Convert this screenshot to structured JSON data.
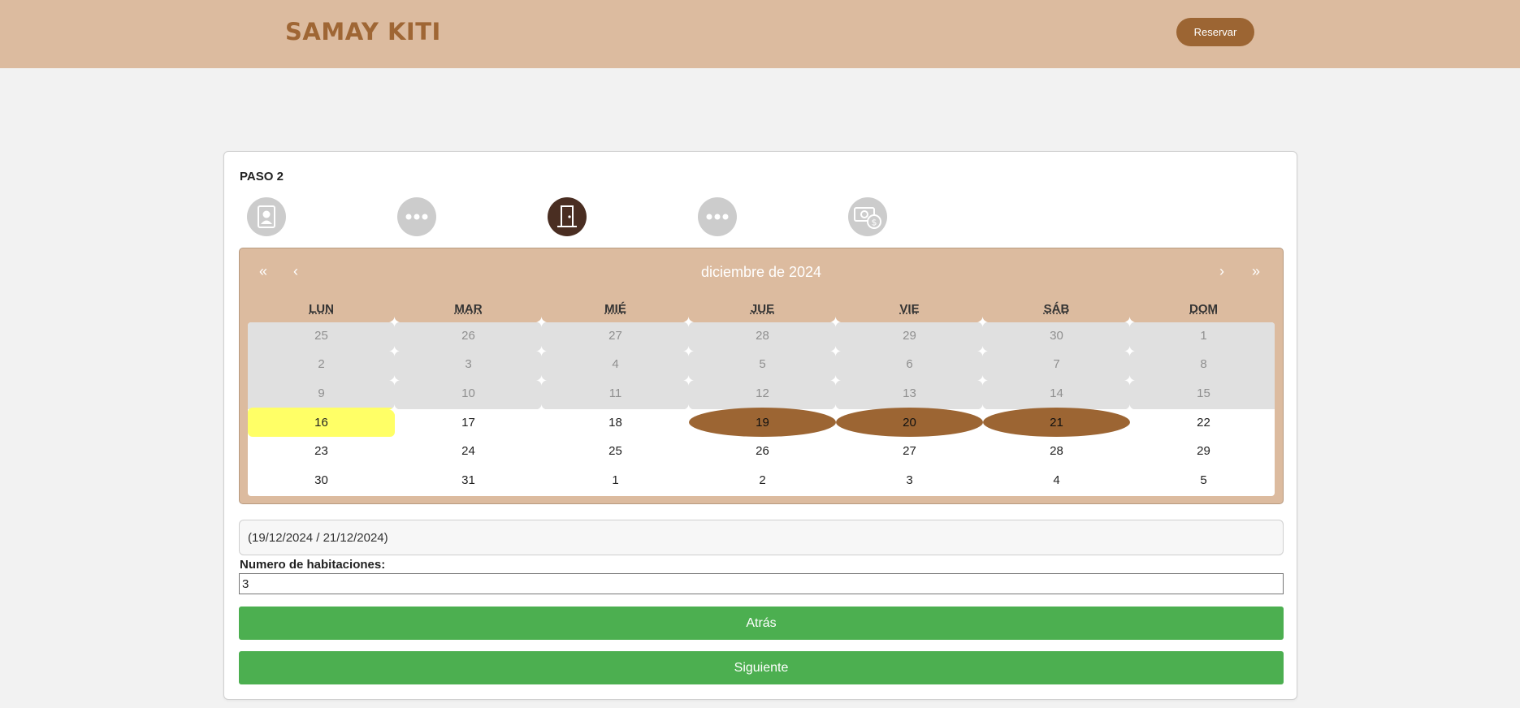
{
  "header": {
    "brand": "SAMAY KITI",
    "reserve_label": "Reservar"
  },
  "step": {
    "label": "PASO 2"
  },
  "steps_icons": [
    "guest-card-icon",
    "more-dots-icon",
    "door-icon",
    "more-dots-icon",
    "payment-icon"
  ],
  "calendar": {
    "title": "diciembre de 2024",
    "nav": {
      "prev_year": "«",
      "prev_month": "‹",
      "next_month": "›",
      "next_year": "»"
    },
    "weekdays": [
      "LUN",
      "MAR",
      "MIÉ",
      "JUE",
      "VIE",
      "SÁB",
      "DOM"
    ],
    "weeks": [
      [
        "25",
        "26",
        "27",
        "28",
        "29",
        "30",
        "1"
      ],
      [
        "2",
        "3",
        "4",
        "5",
        "6",
        "7",
        "8"
      ],
      [
        "9",
        "10",
        "11",
        "12",
        "13",
        "14",
        "15"
      ],
      [
        "16",
        "17",
        "18",
        "19",
        "20",
        "21",
        "22"
      ],
      [
        "23",
        "24",
        "25",
        "26",
        "27",
        "28",
        "29"
      ],
      [
        "30",
        "31",
        "1",
        "2",
        "3",
        "4",
        "5"
      ]
    ],
    "colors": {
      "header_bg": "#dcbb9f",
      "range": "#9c6533",
      "today": "#ffff66",
      "past_bg": "#e0e0e0"
    }
  },
  "form": {
    "range_value": "(19/12/2024 / 21/12/2024)",
    "rooms_label": "Numero de habitaciones:",
    "rooms_value": "3",
    "back_label": "Atrás",
    "next_label": "Siguiente"
  }
}
